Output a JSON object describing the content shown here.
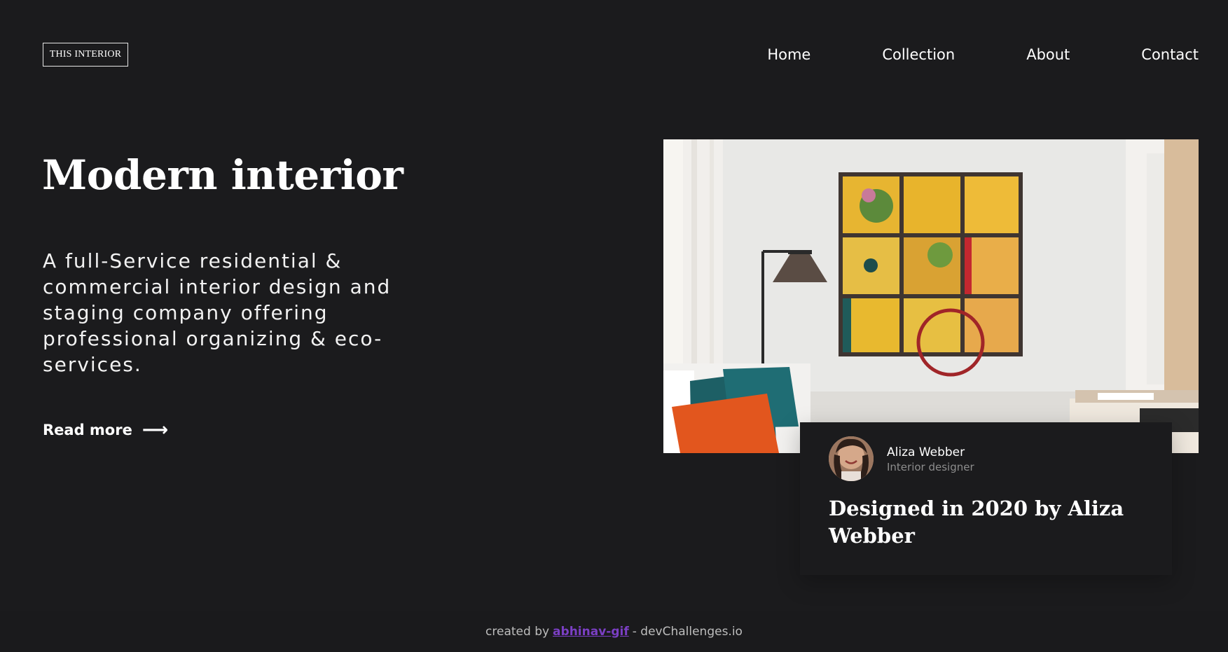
{
  "header": {
    "logo": "THIS INTERIOR",
    "nav": [
      "Home",
      "Collection",
      "About",
      "Contact"
    ]
  },
  "hero": {
    "title": "Modern interior",
    "description": "A full-Service residential & commercial interior design and staging company offering professional organizing & eco-services.",
    "cta_label": "Read more",
    "cta_icon": "arrow-right-icon"
  },
  "feature_card": {
    "name": "Aliza Webber",
    "role": "Interior designer",
    "title": "Designed in 2020 by Aliza Webber"
  },
  "footer": {
    "prefix": "created by",
    "author": "abhinav-gif",
    "suffix": "- devChallenges.io"
  },
  "colors": {
    "background": "#1b1b1d",
    "text": "#ffffff",
    "muted": "#8d8d8d",
    "link": "#7b3fc4",
    "art_yellow": "#e5b52d"
  }
}
